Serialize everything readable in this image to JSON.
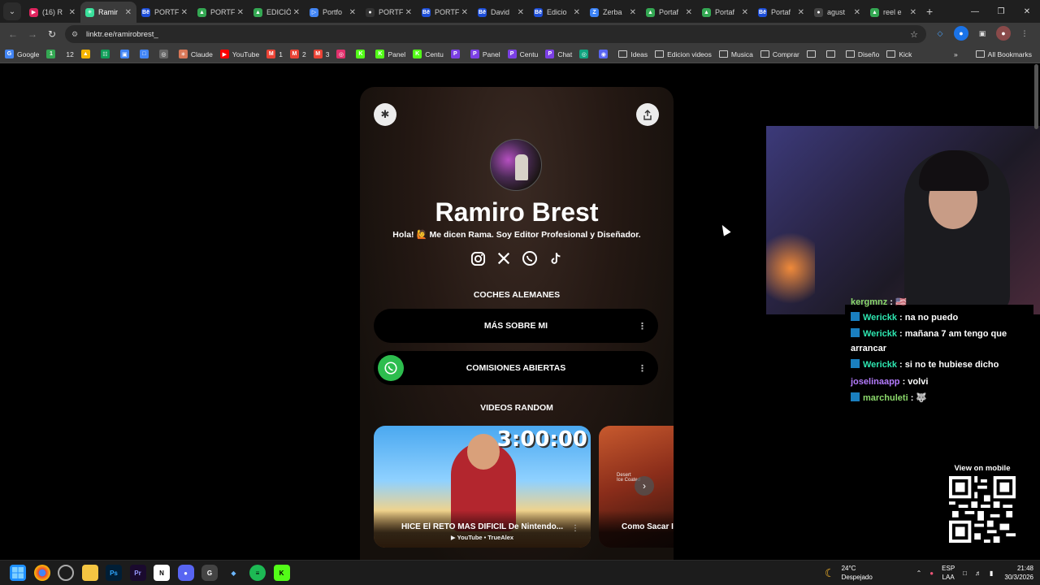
{
  "browser": {
    "tabs": [
      {
        "label": "(16) R",
        "favicon_color": "#e0245e",
        "favicon_glyph": "▶"
      },
      {
        "label": "Ramir",
        "favicon_color": "#39e09b",
        "favicon_glyph": "✳",
        "active": true
      },
      {
        "label": "PORTF",
        "favicon_color": "#1d4ed8",
        "favicon_glyph": "Bē"
      },
      {
        "label": "PORTF",
        "favicon_color": "#34a853",
        "favicon_glyph": "▲"
      },
      {
        "label": "EDICIÓ",
        "favicon_color": "#34a853",
        "favicon_glyph": "▲"
      },
      {
        "label": "Portfo",
        "favicon_color": "#4285f4",
        "favicon_glyph": "▷"
      },
      {
        "label": "PORTF",
        "favicon_color": "#333333",
        "favicon_glyph": "●"
      },
      {
        "label": "PORTF",
        "favicon_color": "#1d4ed8",
        "favicon_glyph": "Bē"
      },
      {
        "label": "David",
        "favicon_color": "#1d4ed8",
        "favicon_glyph": "Bē"
      },
      {
        "label": "Edicio",
        "favicon_color": "#1d4ed8",
        "favicon_glyph": "Bē"
      },
      {
        "label": "Zerba",
        "favicon_color": "#3b82f6",
        "favicon_glyph": "Z"
      },
      {
        "label": "Portaf",
        "favicon_color": "#34a853",
        "favicon_glyph": "▲"
      },
      {
        "label": "Portaf",
        "favicon_color": "#34a853",
        "favicon_glyph": "▲"
      },
      {
        "label": "Portaf",
        "favicon_color": "#1d4ed8",
        "favicon_glyph": "Bē"
      },
      {
        "label": "agust",
        "favicon_color": "#444444",
        "favicon_glyph": "●"
      },
      {
        "label": "reel e",
        "favicon_color": "#34a853",
        "favicon_glyph": "▲"
      }
    ],
    "url": "linktr.ee/ramirobrest_",
    "bookmarks": [
      {
        "label": "Google",
        "color": "#4285f4",
        "glyph": "G"
      },
      {
        "label": "",
        "color": "#34a853",
        "glyph": "1"
      },
      {
        "label": "12",
        "color": "#3b3b3b",
        "glyph": ""
      },
      {
        "label": "",
        "color": "#f4b400",
        "glyph": "▲"
      },
      {
        "label": "",
        "color": "#0f9d58",
        "glyph": "☷"
      },
      {
        "label": "",
        "color": "#4285f4",
        "glyph": "▣"
      },
      {
        "label": "",
        "color": "#4285f4",
        "glyph": "□"
      },
      {
        "label": "",
        "color": "#666666",
        "glyph": "◎"
      },
      {
        "label": "Claude",
        "color": "#d97757",
        "glyph": "✳"
      },
      {
        "label": "YouTube",
        "color": "#ff0000",
        "glyph": "▶"
      },
      {
        "label": "1",
        "color": "#ea4335",
        "glyph": "M"
      },
      {
        "label": "2",
        "color": "#ea4335",
        "glyph": "M"
      },
      {
        "label": "3",
        "color": "#ea4335",
        "glyph": "M"
      },
      {
        "label": "",
        "color": "#e1306c",
        "glyph": "◎"
      },
      {
        "label": "",
        "color": "#53fc18",
        "glyph": "K"
      },
      {
        "label": "Panel",
        "color": "#53fc18",
        "glyph": "K"
      },
      {
        "label": "Centu",
        "color": "#53fc18",
        "glyph": "K"
      },
      {
        "label": "",
        "color": "#7b3fe4",
        "glyph": "P"
      },
      {
        "label": "Panel",
        "color": "#7b3fe4",
        "glyph": "P"
      },
      {
        "label": "Centu",
        "color": "#7b3fe4",
        "glyph": "P"
      },
      {
        "label": "Chat",
        "color": "#7b3fe4",
        "glyph": "P"
      },
      {
        "label": "",
        "color": "#10a37f",
        "glyph": "◎"
      },
      {
        "label": "",
        "color": "#5865f2",
        "glyph": "◉"
      }
    ],
    "bookmark_folders": [
      "Ideas",
      "Edicion videos",
      "Musica",
      "Comprar",
      "",
      "",
      "Diseño",
      "Kick"
    ],
    "all_bookmarks_label": "All Bookmarks"
  },
  "profile": {
    "name": "Ramiro Brest",
    "bio": "Hola! 🙋 Me dicen Rama. Soy Editor Profesional y Diseñador.",
    "social_icons": [
      "instagram-icon",
      "x-icon",
      "whatsapp-icon",
      "tiktok-icon"
    ],
    "section1_title": "COCHES ALEMANES",
    "link1_label": "MÁS SOBRE MI",
    "link2_label": "COMISIONES ABIERTAS",
    "section2_title": "VIDEOS RANDOM",
    "video1_title": "HICE El RETO MAS DIFICIL De Nintendo...",
    "video1_source": "▶ YouTube • TrueAlex",
    "video1_timer": "3:00:00",
    "video2_title": "Como Sacar I",
    "video2_caption": "Desert\nIce Coated"
  },
  "chat": {
    "messages": [
      {
        "user": "kergmnz",
        "text": " : 🇺🇸",
        "color": "lime",
        "badge": false
      },
      {
        "user": "Werickk",
        "text": " : na no puedo",
        "color": "green",
        "badge": true
      },
      {
        "user": "Werickk",
        "text": " : mañana 7 am tengo que arrancar",
        "color": "green",
        "badge": true
      },
      {
        "user": "Werickk",
        "text": " : si no te hubiese dicho",
        "color": "green",
        "badge": true
      },
      {
        "user": "joselinaapp",
        "text": " : volvi",
        "color": "purple",
        "badge": false
      },
      {
        "user": "marchuleti",
        "text": " : 🐺",
        "color": "lime",
        "badge": true
      }
    ]
  },
  "qr": {
    "label": "View on mobile"
  },
  "taskbar": {
    "weather_temp": "24°C",
    "weather_desc": "Despejado",
    "lang_top": "ESP",
    "lang_bottom": "LAA",
    "time": "21:48",
    "date": "30/3/2026"
  }
}
